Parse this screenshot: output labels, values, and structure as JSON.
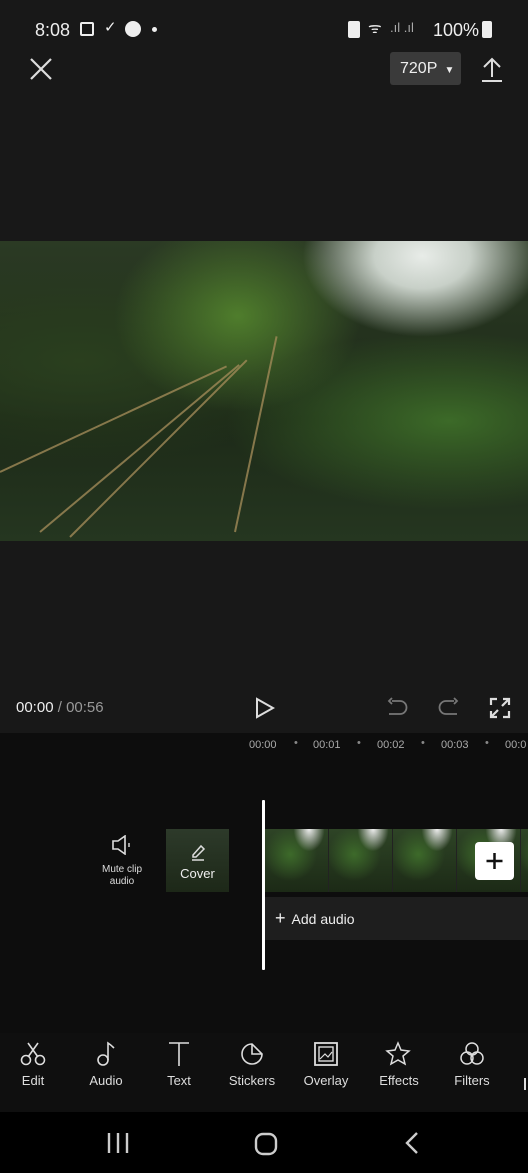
{
  "status_bar": {
    "time": "8:08",
    "battery": "100%"
  },
  "header": {
    "close_icon": "close-icon",
    "resolution": "720P",
    "export_icon": "upload-icon"
  },
  "player": {
    "current_time": "00:00",
    "separator": " / ",
    "total_time": "00:56"
  },
  "ruler": [
    "00:00",
    "00:01",
    "00:02",
    "00:03",
    "00:0"
  ],
  "timeline": {
    "mute_label": "Mute clip audio",
    "cover_label": "Cover",
    "add_audio_label": "Add audio"
  },
  "toolbar": [
    {
      "label": "Edit",
      "icon": "scissors-icon"
    },
    {
      "label": "Audio",
      "icon": "music-note-icon"
    },
    {
      "label": "Text",
      "icon": "text-icon"
    },
    {
      "label": "Stickers",
      "icon": "sticker-icon"
    },
    {
      "label": "Overlay",
      "icon": "overlay-icon"
    },
    {
      "label": "Effects",
      "icon": "star-icon"
    },
    {
      "label": "Filters",
      "icon": "filters-icon"
    }
  ]
}
